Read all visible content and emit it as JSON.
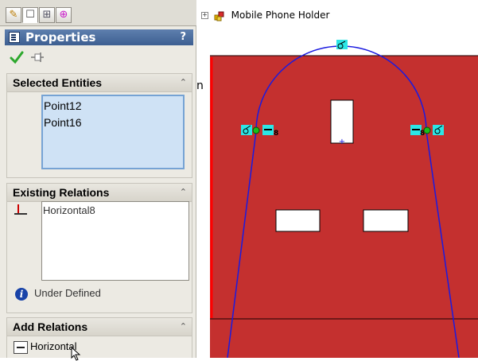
{
  "tabs": [
    {
      "name": "feature-manager",
      "icon": "feature-manager-icon",
      "glyph": "✎"
    },
    {
      "name": "property-manager",
      "icon": "property-manager-icon",
      "glyph": "☐"
    },
    {
      "name": "configuration-manager",
      "icon": "configuration-manager-icon",
      "glyph": "⊞"
    },
    {
      "name": "dimxpert-manager",
      "icon": "dimxpert-manager-icon",
      "glyph": "⊕"
    }
  ],
  "property_manager": {
    "title": "Properties",
    "help": "?"
  },
  "selected_entities": {
    "heading": "Selected Entities",
    "items": [
      "Point12",
      "Point16"
    ]
  },
  "existing_relations": {
    "heading": "Existing Relations",
    "items": [
      "Horizontal8"
    ],
    "status": "Under Defined"
  },
  "add_relations": {
    "heading": "Add Relations",
    "items": [
      "Horizontal"
    ]
  },
  "stray_char": "n",
  "feature_tree": {
    "root_label": "Mobile Phone Holder",
    "expander": "+"
  },
  "sketch": {
    "relation_tag": "8",
    "colors": {
      "face": "#c4302f",
      "sketch_line": "#1a1ae0",
      "relation_bg": "#2ce6e6",
      "point": "#18c018",
      "edge": "#ff0000"
    }
  }
}
